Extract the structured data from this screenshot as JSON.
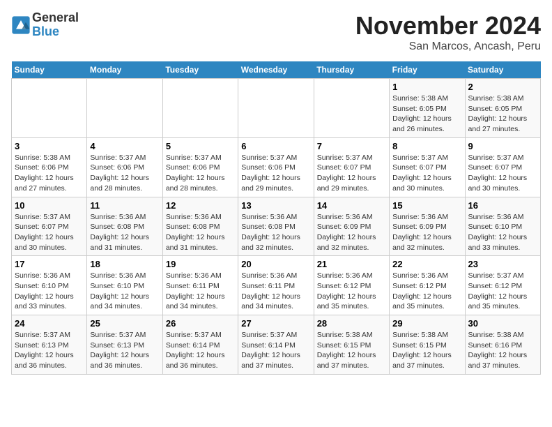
{
  "header": {
    "logo_line1": "General",
    "logo_line2": "Blue",
    "title": "November 2024",
    "subtitle": "San Marcos, Ancash, Peru"
  },
  "calendar": {
    "days_of_week": [
      "Sunday",
      "Monday",
      "Tuesday",
      "Wednesday",
      "Thursday",
      "Friday",
      "Saturday"
    ],
    "weeks": [
      [
        {
          "day": "",
          "info": ""
        },
        {
          "day": "",
          "info": ""
        },
        {
          "day": "",
          "info": ""
        },
        {
          "day": "",
          "info": ""
        },
        {
          "day": "",
          "info": ""
        },
        {
          "day": "1",
          "info": "Sunrise: 5:38 AM\nSunset: 6:05 PM\nDaylight: 12 hours and 26 minutes."
        },
        {
          "day": "2",
          "info": "Sunrise: 5:38 AM\nSunset: 6:05 PM\nDaylight: 12 hours and 27 minutes."
        }
      ],
      [
        {
          "day": "3",
          "info": "Sunrise: 5:38 AM\nSunset: 6:06 PM\nDaylight: 12 hours and 27 minutes."
        },
        {
          "day": "4",
          "info": "Sunrise: 5:37 AM\nSunset: 6:06 PM\nDaylight: 12 hours and 28 minutes."
        },
        {
          "day": "5",
          "info": "Sunrise: 5:37 AM\nSunset: 6:06 PM\nDaylight: 12 hours and 28 minutes."
        },
        {
          "day": "6",
          "info": "Sunrise: 5:37 AM\nSunset: 6:06 PM\nDaylight: 12 hours and 29 minutes."
        },
        {
          "day": "7",
          "info": "Sunrise: 5:37 AM\nSunset: 6:07 PM\nDaylight: 12 hours and 29 minutes."
        },
        {
          "day": "8",
          "info": "Sunrise: 5:37 AM\nSunset: 6:07 PM\nDaylight: 12 hours and 30 minutes."
        },
        {
          "day": "9",
          "info": "Sunrise: 5:37 AM\nSunset: 6:07 PM\nDaylight: 12 hours and 30 minutes."
        }
      ],
      [
        {
          "day": "10",
          "info": "Sunrise: 5:37 AM\nSunset: 6:07 PM\nDaylight: 12 hours and 30 minutes."
        },
        {
          "day": "11",
          "info": "Sunrise: 5:36 AM\nSunset: 6:08 PM\nDaylight: 12 hours and 31 minutes."
        },
        {
          "day": "12",
          "info": "Sunrise: 5:36 AM\nSunset: 6:08 PM\nDaylight: 12 hours and 31 minutes."
        },
        {
          "day": "13",
          "info": "Sunrise: 5:36 AM\nSunset: 6:08 PM\nDaylight: 12 hours and 32 minutes."
        },
        {
          "day": "14",
          "info": "Sunrise: 5:36 AM\nSunset: 6:09 PM\nDaylight: 12 hours and 32 minutes."
        },
        {
          "day": "15",
          "info": "Sunrise: 5:36 AM\nSunset: 6:09 PM\nDaylight: 12 hours and 32 minutes."
        },
        {
          "day": "16",
          "info": "Sunrise: 5:36 AM\nSunset: 6:10 PM\nDaylight: 12 hours and 33 minutes."
        }
      ],
      [
        {
          "day": "17",
          "info": "Sunrise: 5:36 AM\nSunset: 6:10 PM\nDaylight: 12 hours and 33 minutes."
        },
        {
          "day": "18",
          "info": "Sunrise: 5:36 AM\nSunset: 6:10 PM\nDaylight: 12 hours and 34 minutes."
        },
        {
          "day": "19",
          "info": "Sunrise: 5:36 AM\nSunset: 6:11 PM\nDaylight: 12 hours and 34 minutes."
        },
        {
          "day": "20",
          "info": "Sunrise: 5:36 AM\nSunset: 6:11 PM\nDaylight: 12 hours and 34 minutes."
        },
        {
          "day": "21",
          "info": "Sunrise: 5:36 AM\nSunset: 6:12 PM\nDaylight: 12 hours and 35 minutes."
        },
        {
          "day": "22",
          "info": "Sunrise: 5:36 AM\nSunset: 6:12 PM\nDaylight: 12 hours and 35 minutes."
        },
        {
          "day": "23",
          "info": "Sunrise: 5:37 AM\nSunset: 6:12 PM\nDaylight: 12 hours and 35 minutes."
        }
      ],
      [
        {
          "day": "24",
          "info": "Sunrise: 5:37 AM\nSunset: 6:13 PM\nDaylight: 12 hours and 36 minutes."
        },
        {
          "day": "25",
          "info": "Sunrise: 5:37 AM\nSunset: 6:13 PM\nDaylight: 12 hours and 36 minutes."
        },
        {
          "day": "26",
          "info": "Sunrise: 5:37 AM\nSunset: 6:14 PM\nDaylight: 12 hours and 36 minutes."
        },
        {
          "day": "27",
          "info": "Sunrise: 5:37 AM\nSunset: 6:14 PM\nDaylight: 12 hours and 37 minutes."
        },
        {
          "day": "28",
          "info": "Sunrise: 5:38 AM\nSunset: 6:15 PM\nDaylight: 12 hours and 37 minutes."
        },
        {
          "day": "29",
          "info": "Sunrise: 5:38 AM\nSunset: 6:15 PM\nDaylight: 12 hours and 37 minutes."
        },
        {
          "day": "30",
          "info": "Sunrise: 5:38 AM\nSunset: 6:16 PM\nDaylight: 12 hours and 37 minutes."
        }
      ]
    ]
  }
}
